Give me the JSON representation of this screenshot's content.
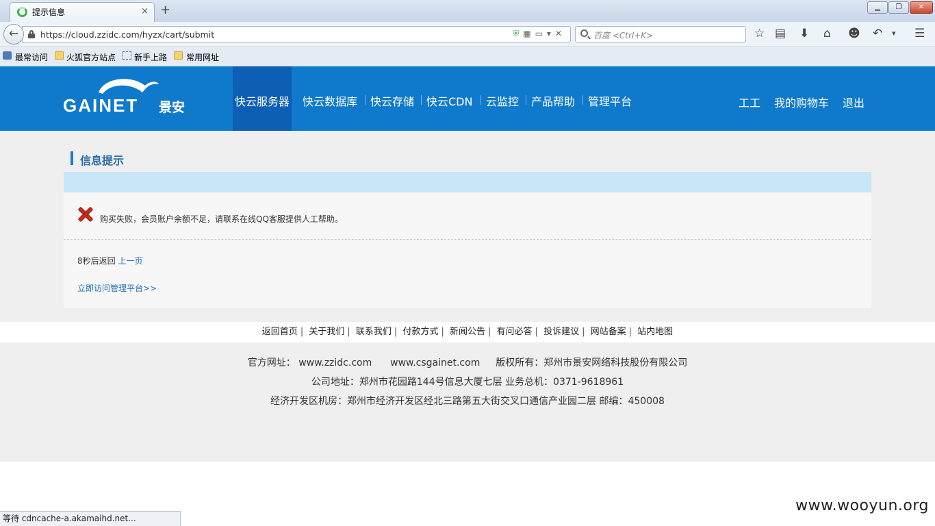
{
  "browser": {
    "tab_title": "提示信息",
    "tab_close": "×",
    "new_tab": "+",
    "window_minimize": "▁",
    "window_maximize": "❐",
    "window_close": "✕",
    "back_glyph": "←",
    "url": "https://cloud.zzidc.com/hyzx/cart/submit",
    "search_placeholder": "百度 <Ctrl+K>",
    "bookmarks": [
      "最常访问",
      "火狐官方站点",
      "新手上路",
      "常用网址"
    ],
    "status_text": "等待 cdncache-a.akamaihd.net..."
  },
  "header": {
    "logo_text": "GAINET",
    "logo_cn": "景安",
    "nav": [
      "快云服务器",
      "快云数据库",
      "快云存储",
      "快云CDN",
      "云监控",
      "产品帮助",
      "管理平台"
    ],
    "active_nav_index": 0,
    "user_links": [
      "工工",
      "我的购物车",
      "退出"
    ],
    "colors": {
      "header_bg": "#0f7acc",
      "active_bg": "#0c5fb4"
    }
  },
  "main": {
    "title": "信息提示",
    "error_message": "购买失败，会员账户余额不足，请联系在线QQ客服提供人工帮助。",
    "countdown_text": "8秒后返回",
    "back_link": "上一页",
    "manage_link": "立即访问管理平台>>"
  },
  "footer": {
    "links": [
      "返回首页",
      "关于我们",
      "联系我们",
      "付款方式",
      "新闻公告",
      "有问必答",
      "投诉建议",
      "网站备案",
      "站内地图"
    ],
    "line1_label": "官方网址：",
    "line1_url1": "www.zzidc.com",
    "line1_url2": "www.csgainet.com",
    "line1_copyright": "版权所有：郑州市景安网络科技股份有限公司",
    "line2": "公司地址：郑州市花园路144号信息大厦七层 业务总机：0371-9618961",
    "line3": "经济开发区机房：郑州市经济开发区经北三路第五大街交叉口通信产业园二层 邮编：450008"
  },
  "watermark": "www.wooyun.org"
}
